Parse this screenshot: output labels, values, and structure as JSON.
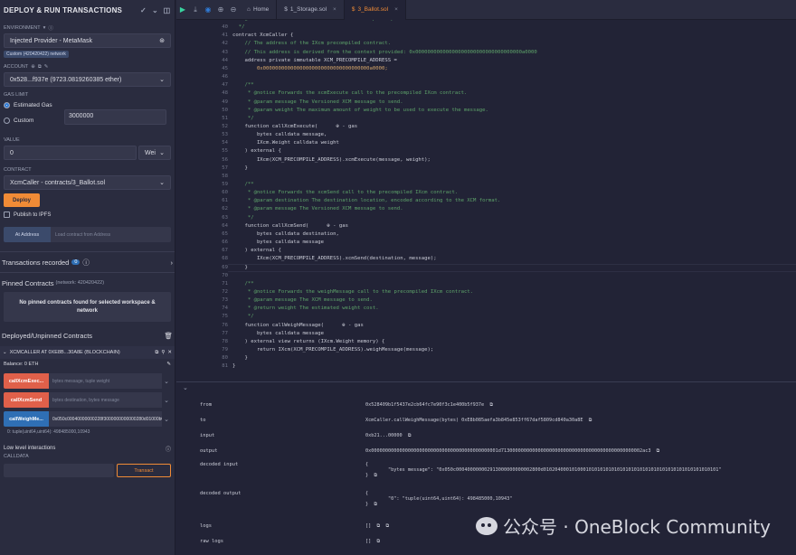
{
  "panel": {
    "title": "DEPLOY & RUN TRANSACTIONS",
    "environment_label": "ENVIRONMENT",
    "environment_value": "Injected Provider - MetaMask",
    "network_badge": "Custom (420420422) network",
    "account_label": "ACCOUNT",
    "account_value": "0x528...f937e (9723.0819260385 ether)",
    "gas_limit_label": "GAS LIMIT",
    "gas_estimated": "Estimated Gas",
    "gas_custom": "Custom",
    "gas_custom_value": "3000000",
    "value_label": "VALUE",
    "value_amount": "0",
    "value_unit": "Wei",
    "contract_label": "CONTRACT",
    "contract_value": "XcmCaller - contracts/3_Ballot.sol",
    "deploy_button": "Deploy",
    "publish_ipfs": "Publish to IPFS",
    "at_address_button": "At Address",
    "at_address_placeholder": "Load contract from Address",
    "transactions_recorded": "Transactions recorded",
    "transactions_count": "0",
    "pinned_title": "Pinned Contracts",
    "pinned_network": "(network: 420420422)",
    "pinned_empty": "No pinned contracts found for selected workspace & network",
    "deployed_title": "Deployed/Unpinned Contracts",
    "instance_name": "XCMCALLER AT 0XE8B...30A8E (BLOCKCHAIN)",
    "balance": "Balance: 0 ETH",
    "functions": [
      {
        "label": "callXcmExec...",
        "params": "bytes message, tuple weight",
        "color": "orange"
      },
      {
        "label": "callXcmSend",
        "params": "bytes destination, bytes message",
        "color": "orange"
      },
      {
        "label": "callWeighMe...",
        "params": "0x050c00040000000228f3000000000000280d01000b010450201",
        "color": "blue"
      }
    ],
    "result": "0: tuple(uint64,uint64): 498485000,10943",
    "low_level": "Low level interactions",
    "calldata_label": "CALLDATA",
    "transact_button": "Transact"
  },
  "tabs": [
    {
      "label": "Home",
      "icon": "home-icon"
    },
    {
      "label": "1_Storage.sol",
      "icon": "file-icon"
    },
    {
      "label": "3_Ballot.sol",
      "icon": "file-icon",
      "active": true
    }
  ],
  "editor": {
    "lines": [
      {
        "n": "39",
        "t": "  * @dev A contract to interact with the IXcm precompile at a fixed address.",
        "c": "com"
      },
      {
        "n": "40",
        "t": "  */",
        "c": "com"
      },
      {
        "n": "41",
        "t": "contract XcmCaller {",
        "c": ""
      },
      {
        "n": "42",
        "t": "    // The address of the IXcm precompiled contract.",
        "c": "com"
      },
      {
        "n": "43",
        "t": "    // This address is derived from the context provided: 0x00000000000000000000000000000000000a0000",
        "c": "com"
      },
      {
        "n": "44",
        "t": "    address private immutable XCM_PRECOMPILE_ADDRESS =",
        "c": ""
      },
      {
        "n": "45",
        "t": "        0x00000000000000000000000000000000000a0000;",
        "c": "num"
      },
      {
        "n": "46",
        "t": "",
        "c": ""
      },
      {
        "n": "47",
        "t": "    /**",
        "c": "com"
      },
      {
        "n": "48",
        "t": "     * @notice Forwards the xcmExecute call to the precompiled IXcm contract.",
        "c": "com"
      },
      {
        "n": "49",
        "t": "     * @param message The Versioned XCM message to send.",
        "c": "com"
      },
      {
        "n": "50",
        "t": "     * @param weight The maximum amount of weight to be used to execute the message.",
        "c": "com"
      },
      {
        "n": "51",
        "t": "     */",
        "c": "com"
      },
      {
        "n": "52",
        "t": "    function callXcmExecute(      ⊕ - gas",
        "c": ""
      },
      {
        "n": "53",
        "t": "        bytes calldata message,",
        "c": ""
      },
      {
        "n": "54",
        "t": "        IXcm.Weight calldata weight",
        "c": ""
      },
      {
        "n": "55",
        "t": "    ) external {",
        "c": ""
      },
      {
        "n": "56",
        "t": "        IXcm(XCM_PRECOMPILE_ADDRESS).xcmExecute(message, weight);",
        "c": ""
      },
      {
        "n": "57",
        "t": "    }",
        "c": ""
      },
      {
        "n": "58",
        "t": "",
        "c": ""
      },
      {
        "n": "59",
        "t": "    /**",
        "c": "com"
      },
      {
        "n": "60",
        "t": "     * @notice Forwards the xcmSend call to the precompiled IXcm contract.",
        "c": "com"
      },
      {
        "n": "61",
        "t": "     * @param destination The destination location, encoded according to the XCM format.",
        "c": "com"
      },
      {
        "n": "62",
        "t": "     * @param message The Versioned XCM message to send.",
        "c": "com"
      },
      {
        "n": "63",
        "t": "     */",
        "c": "com"
      },
      {
        "n": "64",
        "t": "    function callXcmSend(      ⊕ - gas",
        "c": ""
      },
      {
        "n": "65",
        "t": "        bytes calldata destination,",
        "c": ""
      },
      {
        "n": "66",
        "t": "        bytes calldata message",
        "c": ""
      },
      {
        "n": "67",
        "t": "    ) external {",
        "c": ""
      },
      {
        "n": "68",
        "t": "        IXcm(XCM_PRECOMPILE_ADDRESS).xcmSend(destination, message);",
        "c": ""
      },
      {
        "n": "69",
        "t": "    }",
        "c": ""
      },
      {
        "n": "70",
        "t": "",
        "c": ""
      },
      {
        "n": "71",
        "t": "    /**",
        "c": "com"
      },
      {
        "n": "72",
        "t": "     * @notice Forwards the weighMessage call to the precompiled IXcm contract.",
        "c": "com"
      },
      {
        "n": "73",
        "t": "     * @param message The XCM message to send.",
        "c": "com"
      },
      {
        "n": "74",
        "t": "     * @return weight The estimated weight cost.",
        "c": "com"
      },
      {
        "n": "75",
        "t": "     */",
        "c": "com"
      },
      {
        "n": "76",
        "t": "    function callWeighMessage(      ⊕ - gas",
        "c": ""
      },
      {
        "n": "77",
        "t": "        bytes calldata message",
        "c": ""
      },
      {
        "n": "78",
        "t": "    ) external view returns (IXcm.Weight memory) {",
        "c": ""
      },
      {
        "n": "79",
        "t": "        return IXcm(XCM_PRECOMPILE_ADDRESS).weighMessage(message);",
        "c": ""
      },
      {
        "n": "80",
        "t": "    }",
        "c": ""
      },
      {
        "n": "81",
        "t": "}",
        "c": ""
      }
    ]
  },
  "terminal": {
    "rows": [
      {
        "k": "from",
        "v": "0x528409b1f5437e2cb64fc7e90f3c1e400b5f937e  ⧉"
      },
      {
        "k": "to",
        "v": "XcmCaller.callWeighMessage(bytes) 0xE8b085aefa3b845e853ff67daf5809cd840a30a8E  ⧉"
      },
      {
        "k": "input",
        "v": "0xb21...00000  ⧉"
      },
      {
        "k": "output",
        "v": "0x000000000000000000000000000000000000000000001d71300000000000000000000000000000000000000000000002ac3  ⧉"
      },
      {
        "k": "decoded input",
        "v": "{\n\t\"bytes message\": \"0x050c000400000002913000000000002800d01020400010100010101010101010101010101010101010101010101010101\"\n}  ⧉"
      },
      {
        "k": "decoded output",
        "v": "{\n\t\"0\": \"tuple(uint64,uint64): 498485000,10943\"\n}  ⧉"
      },
      {
        "k": "logs",
        "v": "[]  ⧉  ⧉"
      },
      {
        "k": "raw logs",
        "v": "[]  ⧉"
      }
    ]
  },
  "watermark": "公众号 · OneBlock Community"
}
